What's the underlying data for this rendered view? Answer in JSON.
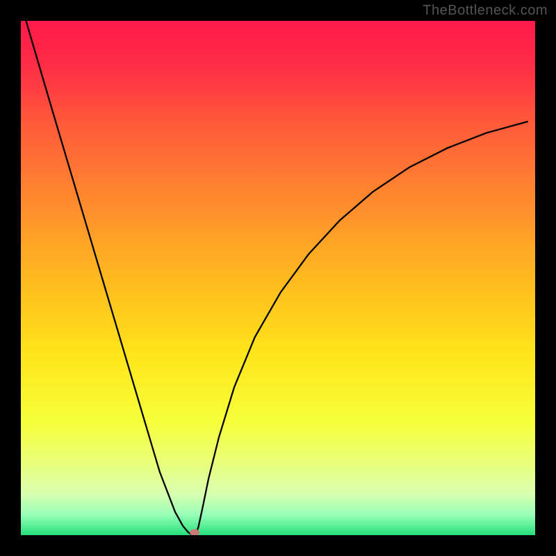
{
  "watermark": "TheBottleneck.com",
  "chart_data": {
    "type": "line",
    "title": "",
    "xlabel": "",
    "ylabel": "",
    "xlim": [
      0,
      1
    ],
    "ylim": [
      0,
      1
    ],
    "background_gradient": {
      "stops": [
        {
          "offset": 0.0,
          "color": "#ff1a4b"
        },
        {
          "offset": 0.08,
          "color": "#ff2a46"
        },
        {
          "offset": 0.2,
          "color": "#ff5a3a"
        },
        {
          "offset": 0.35,
          "color": "#ff8a2e"
        },
        {
          "offset": 0.5,
          "color": "#ffb91f"
        },
        {
          "offset": 0.65,
          "color": "#ffe51a"
        },
        {
          "offset": 0.78,
          "color": "#f6ff3a"
        },
        {
          "offset": 0.86,
          "color": "#e9ff7a"
        },
        {
          "offset": 0.92,
          "color": "#d8ffb0"
        },
        {
          "offset": 0.96,
          "color": "#98ffb8"
        },
        {
          "offset": 1.0,
          "color": "#25e07c"
        }
      ]
    },
    "series": [
      {
        "name": "bottleneck-curve",
        "x": [
          0.01,
          0.03,
          0.06,
          0.09,
          0.12,
          0.15,
          0.18,
          0.21,
          0.24,
          0.27,
          0.3,
          0.315,
          0.325,
          0.332,
          0.336,
          0.34,
          0.345,
          0.352,
          0.365,
          0.385,
          0.415,
          0.455,
          0.505,
          0.56,
          0.62,
          0.685,
          0.755,
          0.83,
          0.905,
          0.985
        ],
        "y": [
          1.0,
          0.932,
          0.83,
          0.729,
          0.628,
          0.527,
          0.426,
          0.325,
          0.224,
          0.123,
          0.045,
          0.018,
          0.006,
          0.001,
          0.0,
          0.003,
          0.015,
          0.047,
          0.11,
          0.19,
          0.288,
          0.385,
          0.472,
          0.547,
          0.612,
          0.668,
          0.715,
          0.753,
          0.782,
          0.804
        ]
      }
    ],
    "marker": {
      "x": 0.338,
      "y": 0.005,
      "color": "#c97a78"
    }
  }
}
